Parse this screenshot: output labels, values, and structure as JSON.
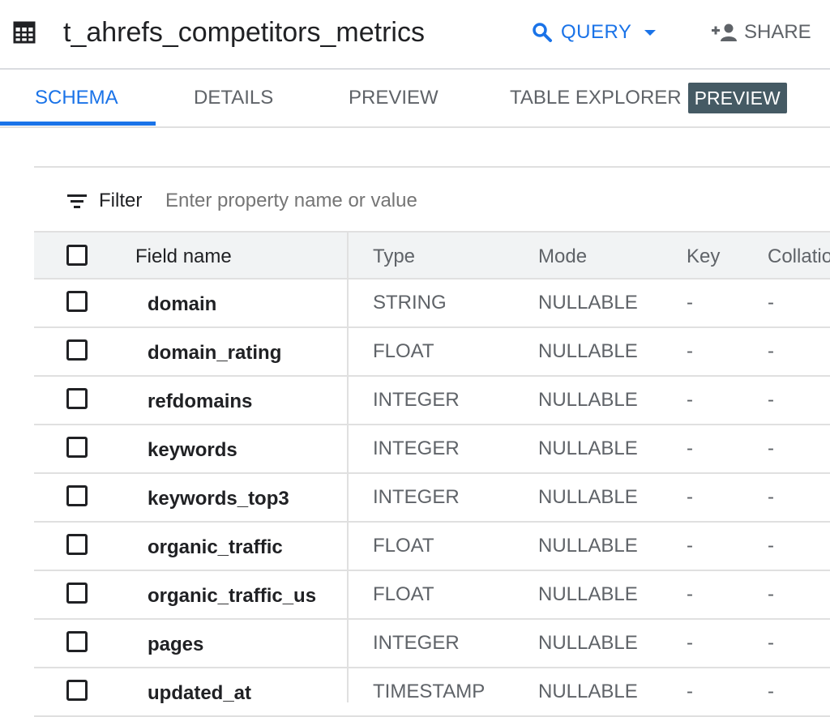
{
  "header": {
    "title": "t_ahrefs_competitors_metrics",
    "query_label": "QUERY",
    "share_label": "SHARE"
  },
  "icons": {
    "table": "table-grid-icon",
    "search": "search-icon",
    "caret": "caret-down-icon",
    "person_add": "person-add-icon",
    "filter": "filter-list-icon"
  },
  "tabs": [
    {
      "label": "SCHEMA",
      "active": true
    },
    {
      "label": "DETAILS",
      "active": false
    },
    {
      "label": "PREVIEW",
      "active": false
    },
    {
      "label": "TABLE EXPLORER",
      "active": false,
      "badge": "PREVIEW"
    }
  ],
  "filter": {
    "label": "Filter",
    "placeholder": "Enter property name or value",
    "value": ""
  },
  "table": {
    "columns": [
      "Field name",
      "Type",
      "Mode",
      "Key",
      "Collatio"
    ],
    "rows": [
      {
        "name": "domain",
        "type": "STRING",
        "mode": "NULLABLE",
        "key": "-",
        "collation": "-"
      },
      {
        "name": "domain_rating",
        "type": "FLOAT",
        "mode": "NULLABLE",
        "key": "-",
        "collation": "-"
      },
      {
        "name": "refdomains",
        "type": "INTEGER",
        "mode": "NULLABLE",
        "key": "-",
        "collation": "-"
      },
      {
        "name": "keywords",
        "type": "INTEGER",
        "mode": "NULLABLE",
        "key": "-",
        "collation": "-"
      },
      {
        "name": "keywords_top3",
        "type": "INTEGER",
        "mode": "NULLABLE",
        "key": "-",
        "collation": "-"
      },
      {
        "name": "organic_traffic",
        "type": "FLOAT",
        "mode": "NULLABLE",
        "key": "-",
        "collation": "-"
      },
      {
        "name": "organic_traffic_us",
        "type": "FLOAT",
        "mode": "NULLABLE",
        "key": "-",
        "collation": "-"
      },
      {
        "name": "pages",
        "type": "INTEGER",
        "mode": "NULLABLE",
        "key": "-",
        "collation": "-"
      },
      {
        "name": "updated_at",
        "type": "TIMESTAMP",
        "mode": "NULLABLE",
        "key": "-",
        "collation": "-"
      }
    ]
  },
  "colors": {
    "accent": "#1a73e8",
    "badge_bg": "#455a64",
    "header_bg": "#f1f3f4",
    "divider": "#e0e0e0"
  }
}
